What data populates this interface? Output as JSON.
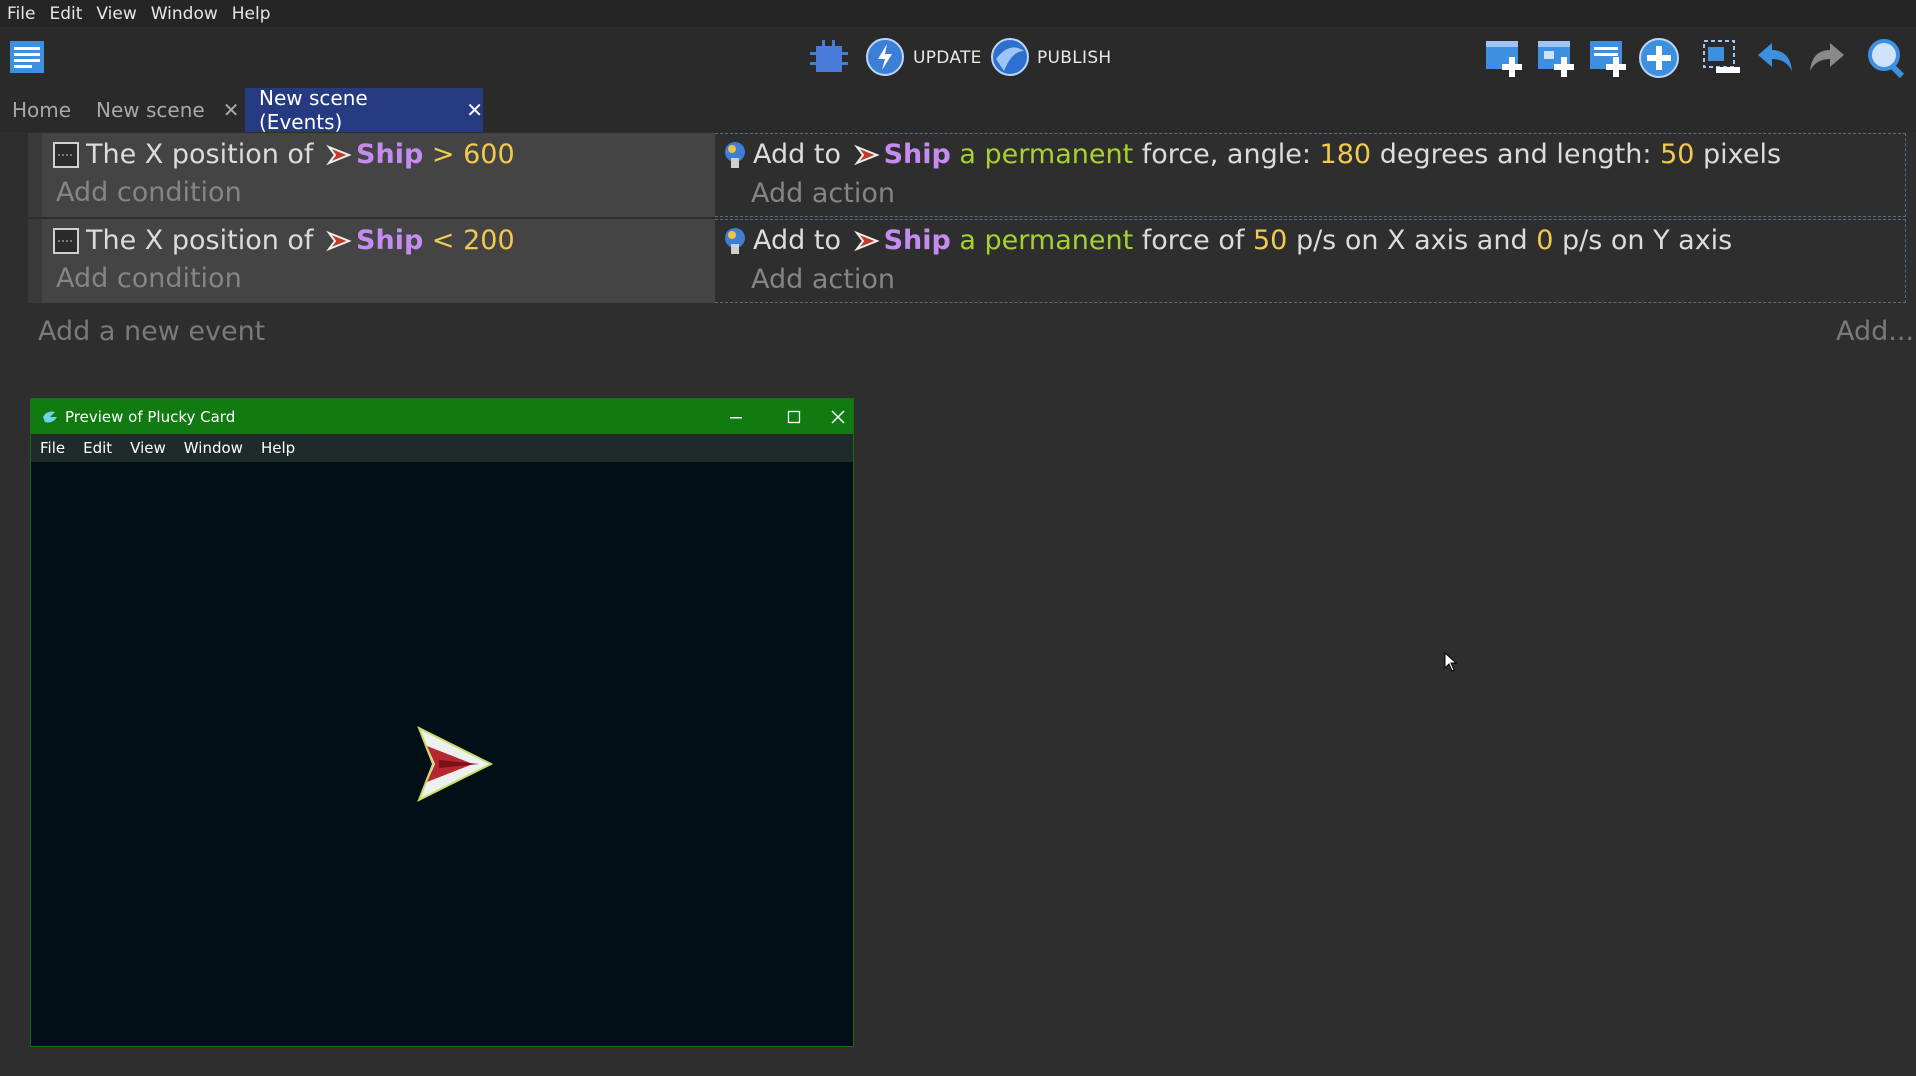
{
  "menu": [
    "File",
    "Edit",
    "View",
    "Window",
    "Help"
  ],
  "toolbar": {
    "update_label": "UPDATE",
    "publish_label": "PUBLISH"
  },
  "tabs": [
    {
      "label": "Home"
    },
    {
      "label": "New scene"
    },
    {
      "label": "New scene (Events)"
    }
  ],
  "events": [
    {
      "condition": {
        "prefix": "The X position of",
        "object": "Ship",
        "operator": ">",
        "value": "600"
      },
      "condition_placeholder": "Add condition",
      "action": {
        "prefix": "Add to",
        "object": "Ship",
        "kind": "a permanent",
        "mid": "force, angle:",
        "angle": "180",
        "mid2": "degrees and length:",
        "length": "50",
        "suffix": "pixels"
      },
      "action_placeholder": "Add action"
    },
    {
      "condition": {
        "prefix": "The X position of",
        "object": "Ship",
        "operator": "<",
        "value": "200"
      },
      "condition_placeholder": "Add condition",
      "action": {
        "prefix": "Add to",
        "object": "Ship",
        "kind": "a permanent",
        "mid": "force of",
        "x": "50",
        "mid2": "p/s on X axis and",
        "y": "0",
        "suffix": "p/s on Y axis"
      },
      "action_placeholder": "Add action"
    }
  ],
  "add_event_label": "Add a new event",
  "add_more_label": "Add...",
  "preview": {
    "title": "Preview of Plucky Card",
    "menu": [
      "File",
      "Edit",
      "View",
      "Window",
      "Help"
    ]
  },
  "colors": {
    "object": "#c58bf0",
    "number": "#f2c94c",
    "keyword": "#a6d133",
    "active_tab": "#253a80",
    "preview_titlebar": "#117a11"
  }
}
